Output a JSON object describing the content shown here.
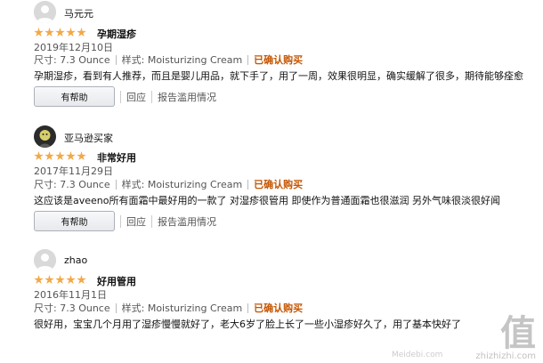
{
  "reviews": [
    {
      "username": "马元元",
      "avatar": "default-avatar",
      "rating": 5,
      "title": "孕期湿疹",
      "date": "2019年12月10日",
      "size": "尺寸: 7.3 Ounce",
      "style": "样式: Moisturizing Cream",
      "verified": "已确认购买",
      "text": "孕期湿疹，看到有人推荐，而且是婴儿用品，就下手了，用了一周，效果很明显，确实缓解了很多，期待能够痊愈",
      "helpful_label": "有帮助",
      "comment_label": "回应",
      "report_label": "报告滥用情况"
    },
    {
      "username": "亚马逊买家",
      "avatar": "custom-avatar",
      "rating": 5,
      "title": "非常好用",
      "date": "2017年11月29日",
      "size": "尺寸: 7.3 Ounce",
      "style": "样式: Moisturizing Cream",
      "verified": "已确认购买",
      "text": "这应该是aveeno所有面霜中最好用的一款了 对湿疹很管用 即使作为普通面霜也很滋润 另外气味很淡很好闻",
      "helpful_label": "有帮助",
      "comment_label": "回应",
      "report_label": "报告滥用情况"
    },
    {
      "username": "zhao",
      "avatar": "default-avatar",
      "rating": 5,
      "title": "好用管用",
      "date": "2016年11月1日",
      "size": "尺寸: 7.3 Ounce",
      "style": "样式: Moisturizing Cream",
      "verified": "已确认购买",
      "text": "很好用，宝宝几个月用了湿疹慢慢就好了，老大6岁了脸上长了一些小湿疹好久了，用了基本快好了",
      "helpful_label": "有帮助",
      "comment_label": "回应",
      "report_label": "报告滥用情况"
    }
  ],
  "colors": {
    "star": "#f3a847",
    "verified": "#c45500"
  },
  "watermark": {
    "logo": "值",
    "site": "zhizhizhi.com",
    "small": "Meidebi.com"
  }
}
